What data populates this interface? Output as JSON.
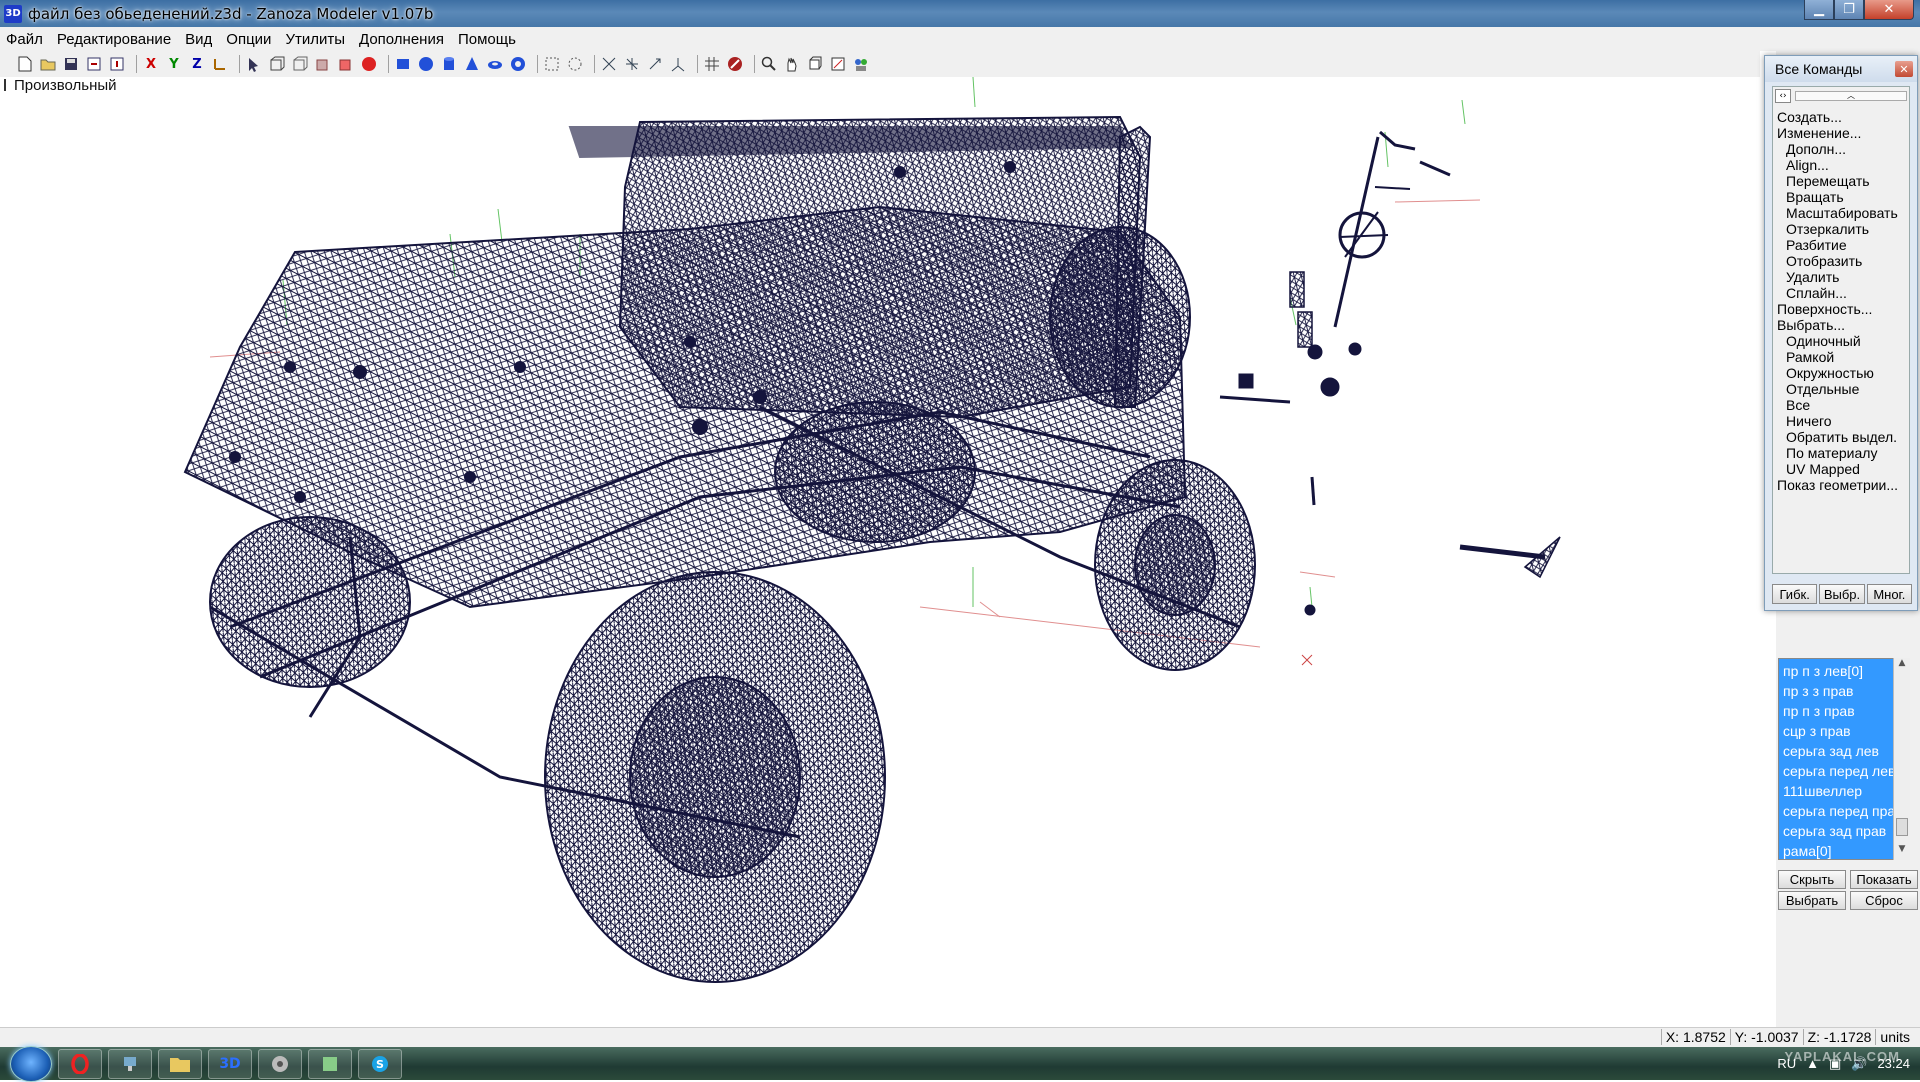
{
  "window": {
    "title": "файл без обьеденений.z3d - Zanoza Modeler v1.07b",
    "logo": "3D"
  },
  "menu": {
    "items": [
      "Файл",
      "Редактирование",
      "Вид",
      "Опции",
      "Утилиты",
      "Дополнения",
      "Помощь"
    ]
  },
  "toolbar": {
    "axis_x": "X",
    "axis_y": "Y",
    "axis_z": "Z"
  },
  "viewport": {
    "label": "Произвольный",
    "wire_color": "#14143c"
  },
  "commands": {
    "title": "Все Команды",
    "items": [
      {
        "text": "Создать...",
        "level": 0
      },
      {
        "text": "Изменение...",
        "level": 0
      },
      {
        "text": "Дополн...",
        "level": 1
      },
      {
        "text": "Align...",
        "level": 1
      },
      {
        "text": "Перемещать",
        "level": 1
      },
      {
        "text": "Вращать",
        "level": 1
      },
      {
        "text": "Масштабировать",
        "level": 1
      },
      {
        "text": "Отзеркалить",
        "level": 1
      },
      {
        "text": "Разбитие",
        "level": 1
      },
      {
        "text": "Отобразить",
        "level": 1
      },
      {
        "text": "Удалить",
        "level": 1
      },
      {
        "text": "Сплайн...",
        "level": 1
      },
      {
        "text": "Поверхность...",
        "level": 0
      },
      {
        "text": "Выбрать...",
        "level": 0
      },
      {
        "text": "Одиночный",
        "level": 1
      },
      {
        "text": "Рамкой",
        "level": 1
      },
      {
        "text": "Окружностью",
        "level": 1
      },
      {
        "text": "Отдельные",
        "level": 1
      },
      {
        "text": "Все",
        "level": 1
      },
      {
        "text": "Ничего",
        "level": 1
      },
      {
        "text": "Обратить выдел.",
        "level": 1
      },
      {
        "text": "По материалу",
        "level": 1
      },
      {
        "text": "UV Mapped",
        "level": 1
      },
      {
        "text": "Показ геометрии...",
        "level": 0
      }
    ],
    "buttons": [
      "Гибк.",
      "Выбр.",
      "Мног."
    ]
  },
  "objects": {
    "items": [
      "пр п з лев[0]",
      "пр з з прав",
      "пр п з прав",
      "сцр з прав",
      "серьга зад лев",
      "серьга перед лев",
      "111швеллер",
      "серьга перед прав",
      "серьга зад прав",
      "рама[0]"
    ],
    "selection_color": "#3399ff",
    "buttons": {
      "hide": "Скрыть",
      "show": "Показать",
      "select": "Выбрать",
      "reset": "Сброс"
    }
  },
  "status": {
    "x": "X: 1.8752",
    "y": "Y: -1.0037",
    "z": "Z: -1.1728",
    "units": "units"
  },
  "taskbar": {
    "app_label": "3D",
    "lang": "RU",
    "time": "23:24",
    "watermark": "YAPLAKAL.COM"
  }
}
